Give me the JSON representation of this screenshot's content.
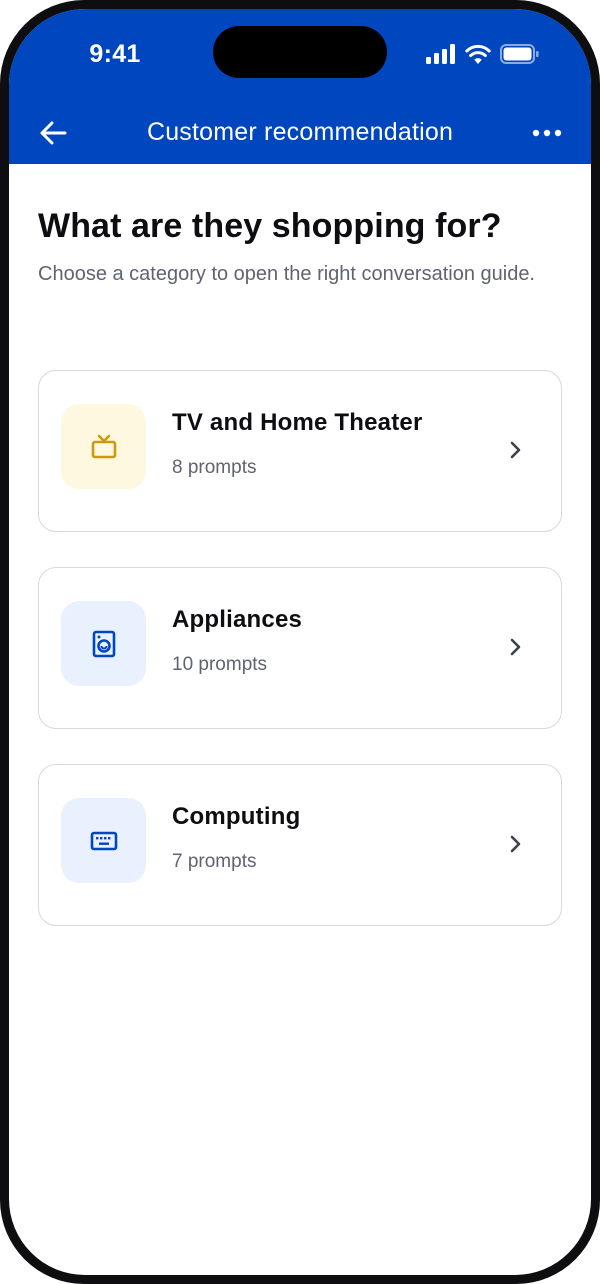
{
  "status_bar": {
    "time": "9:41"
  },
  "navbar": {
    "title": "Customer recommendation"
  },
  "page": {
    "title": "What are they shopping for?",
    "subtitle": "Choose a category to open the right conversation guide."
  },
  "categories": [
    {
      "name": "TV and Home Theater",
      "count": "8 prompts",
      "icon": "tv-icon",
      "icon_color": "#c99a0a",
      "icon_bg": "#fff8e0"
    },
    {
      "name": "Appliances",
      "count": "10 prompts",
      "icon": "washing-machine-icon",
      "icon_color": "#0046be",
      "icon_bg": "#e9f1fe"
    },
    {
      "name": "Computing",
      "count": "7 prompts",
      "icon": "keyboard-icon",
      "icon_color": "#0046be",
      "icon_bg": "#e9f1fe"
    }
  ],
  "colors": {
    "header": "#0046be",
    "title_text": "#0e0e12",
    "secondary_text": "#5f6472",
    "card_border": "#d6d9df"
  }
}
